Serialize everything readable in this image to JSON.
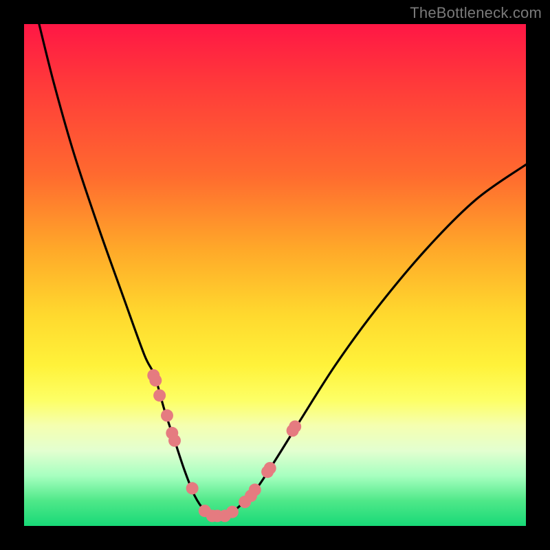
{
  "watermark": "TheBottleneck.com",
  "chart_data": {
    "type": "line",
    "title": "",
    "xlabel": "",
    "ylabel": "",
    "xlim": [
      0,
      1
    ],
    "ylim": [
      0,
      1
    ],
    "series": [
      {
        "name": "bottleneck-curve",
        "x": [
          0.03,
          0.06,
          0.1,
          0.15,
          0.2,
          0.24,
          0.26,
          0.28,
          0.3,
          0.32,
          0.34,
          0.36,
          0.375,
          0.39,
          0.41,
          0.43,
          0.46,
          0.5,
          0.55,
          0.62,
          0.7,
          0.8,
          0.9,
          1.0
        ],
        "y": [
          1.0,
          0.88,
          0.74,
          0.59,
          0.45,
          0.34,
          0.3,
          0.23,
          0.17,
          0.11,
          0.06,
          0.03,
          0.02,
          0.02,
          0.025,
          0.04,
          0.07,
          0.13,
          0.21,
          0.32,
          0.43,
          0.55,
          0.65,
          0.72
        ]
      }
    ],
    "markers": {
      "name": "highlight-dots",
      "x": [
        0.258,
        0.262,
        0.27,
        0.285,
        0.295,
        0.3,
        0.335,
        0.36,
        0.375,
        0.385,
        0.4,
        0.415,
        0.44,
        0.452,
        0.46,
        0.485,
        0.49,
        0.535,
        0.54
      ],
      "y": [
        0.3,
        0.29,
        0.26,
        0.22,
        0.185,
        0.17,
        0.075,
        0.03,
        0.02,
        0.02,
        0.02,
        0.028,
        0.048,
        0.06,
        0.072,
        0.108,
        0.115,
        0.19,
        0.198
      ]
    },
    "colors": {
      "curve": "#000000",
      "markers": "#e57b80",
      "gradient_top": "#ff1745",
      "gradient_bottom": "#18d977"
    }
  }
}
